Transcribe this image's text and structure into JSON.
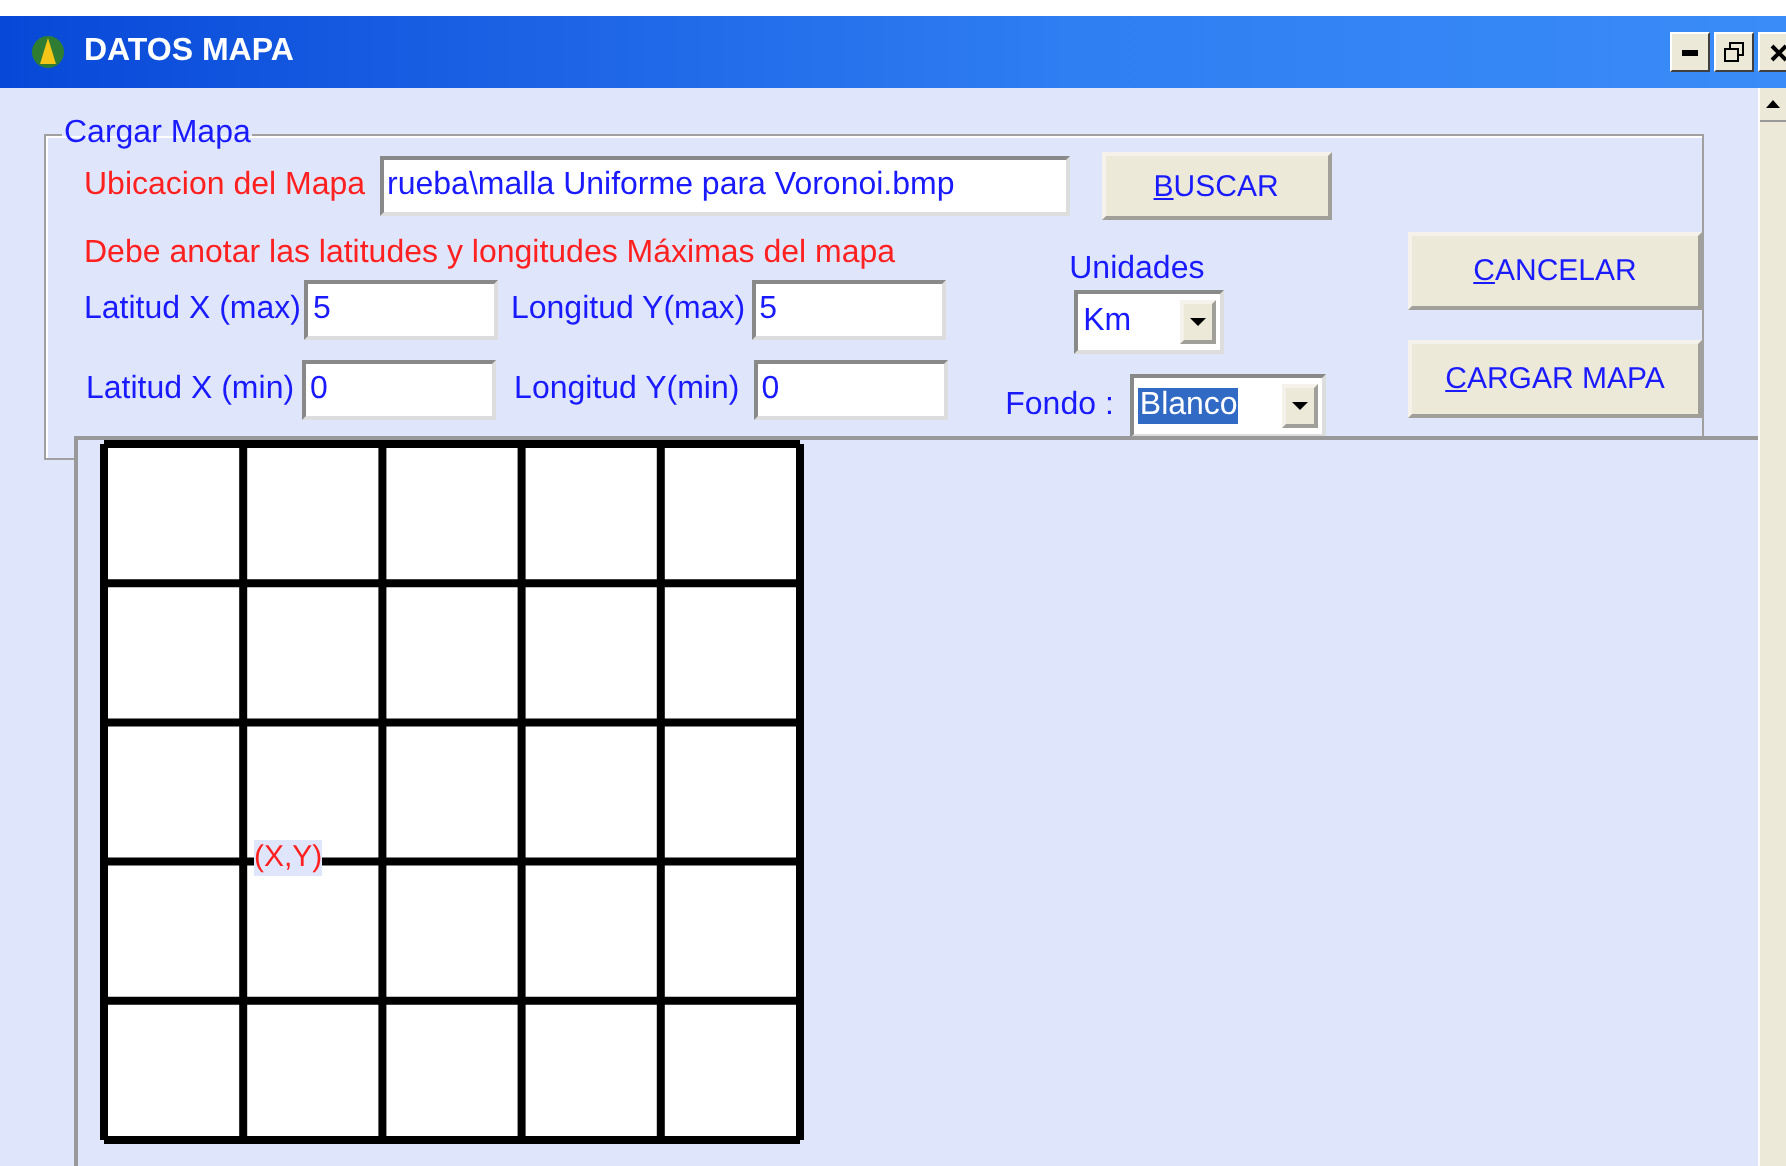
{
  "window": {
    "title": "DATOS MAPA"
  },
  "group": {
    "title": "Cargar Mapa",
    "map_location": {
      "label": "Ubicacion del Mapa",
      "value": "rueba\\malla Uniforme para Voronoi.bmp"
    },
    "search_button": {
      "mnemonic": "B",
      "rest": "USCAR"
    },
    "instruction": "Debe anotar las latitudes y longitudes Máximas del mapa",
    "units": {
      "label": "Unidades",
      "value": "Km",
      "focused": false
    },
    "lat_max": {
      "label": "Latitud X (max)",
      "value": "5"
    },
    "lon_max": {
      "label": "Longitud Y(max)",
      "value": "5"
    },
    "lat_min": {
      "label": "Latitud X (min)",
      "value": "0"
    },
    "lon_min": {
      "label": "Longitud Y(min)",
      "value": "0"
    },
    "background": {
      "label": "Fondo :",
      "value": "Blanco",
      "focused": true
    },
    "cancel_button": {
      "mnemonic": "C",
      "rest": "ANCELAR"
    },
    "load_button": {
      "mnemonic": "C",
      "rest": "ARGAR MAPA"
    }
  },
  "map": {
    "point_label": "(X,Y)"
  }
}
